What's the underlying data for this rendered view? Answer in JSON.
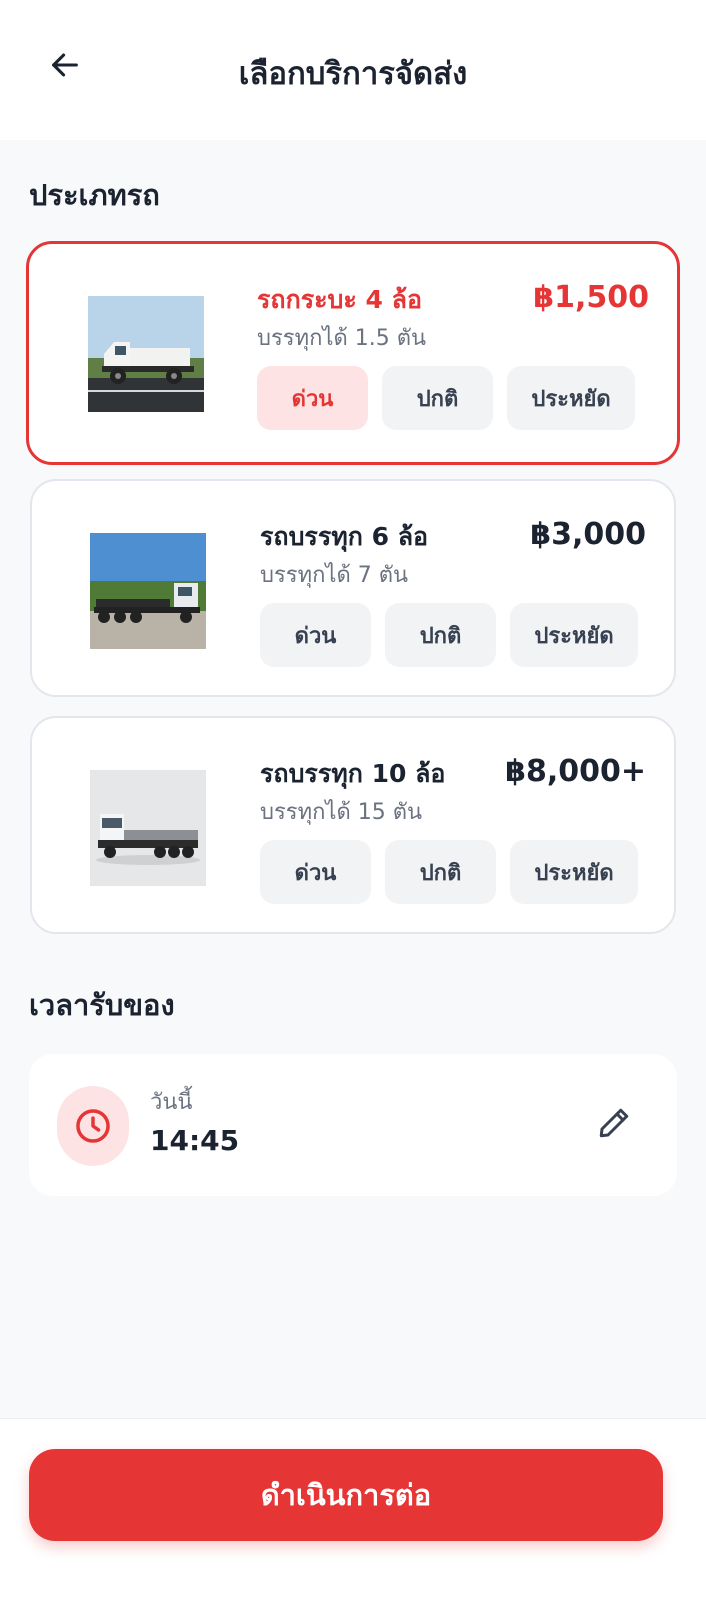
{
  "header": {
    "title": "เลือกบริการจัดส่ง"
  },
  "vehicle_section": {
    "title": "ประเภทรถ"
  },
  "vehicles": [
    {
      "name": "รถกระบะ 4 ล้อ",
      "capacity": "บรรทุกได้ 1.5 ตัน",
      "price": "฿1,500",
      "options": [
        "ด่วน",
        "ปกติ",
        "ประหยัด"
      ],
      "selected": true,
      "active_option": 0
    },
    {
      "name": "รถบรรทุก 6 ล้อ",
      "capacity": "บรรทุกได้ 7 ตัน",
      "price": "฿3,000",
      "options": [
        "ด่วน",
        "ปกติ",
        "ประหยัด"
      ],
      "selected": false
    },
    {
      "name": "รถบรรทุก 10 ล้อ",
      "capacity": "บรรทุกได้ 15 ตัน",
      "price": "฿8,000+",
      "options": [
        "ด่วน",
        "ปกติ",
        "ประหยัด"
      ],
      "selected": false
    }
  ],
  "pickup_section": {
    "title": "เวลารับของ"
  },
  "pickup": {
    "day": "วันนี้",
    "time": "14:45"
  },
  "footer": {
    "continue_label": "ดำเนินการต่อ"
  },
  "colors": {
    "accent": "#e53535",
    "accent_soft": "#fde3e3",
    "text": "#1c2330",
    "muted": "#6b7280"
  },
  "icons": {
    "back": "arrow-left-icon",
    "clock": "clock-icon",
    "edit": "pencil-icon"
  }
}
